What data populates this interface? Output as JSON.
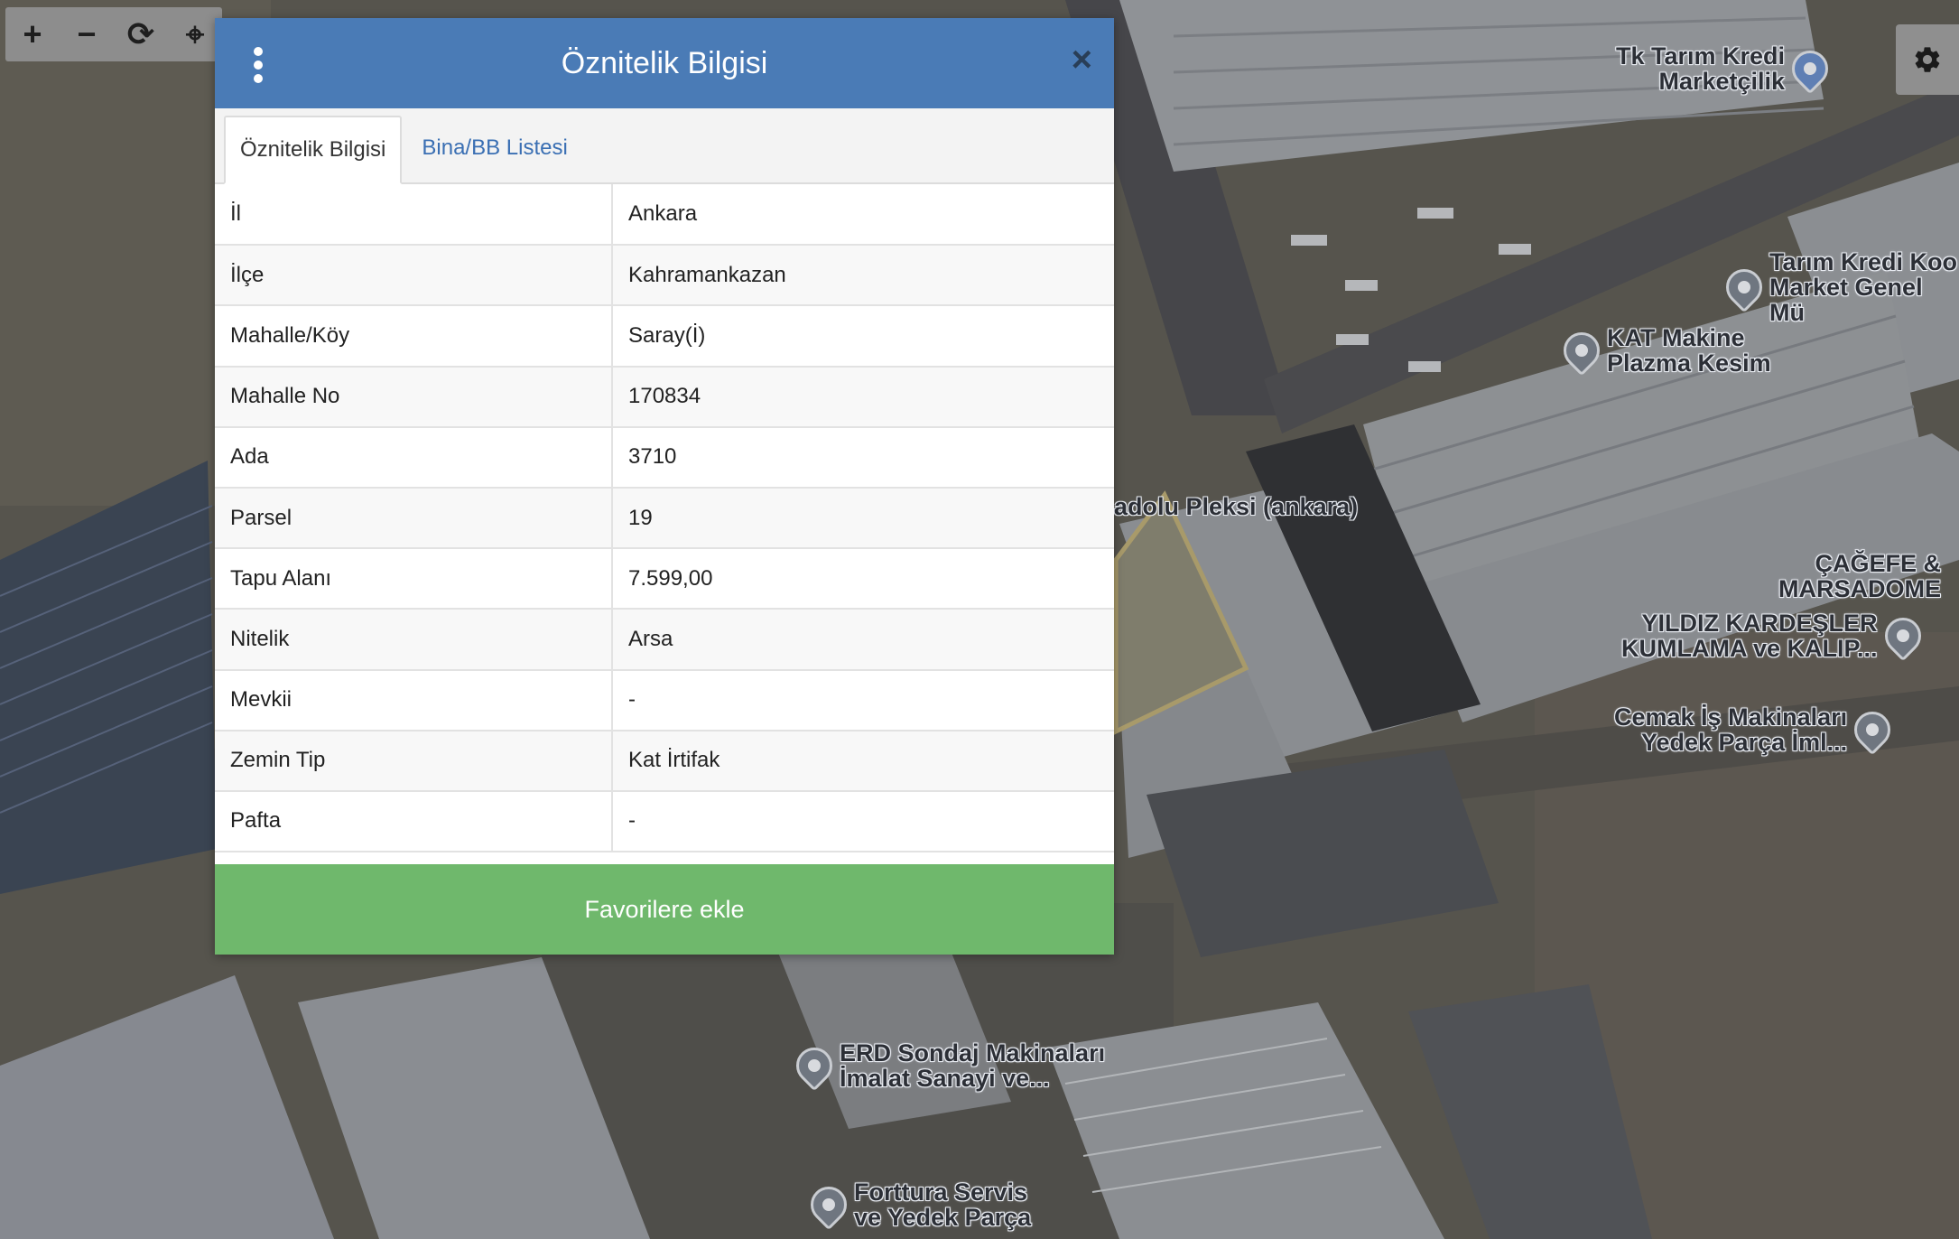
{
  "map": {
    "toolbar": {
      "zoom_in": "+",
      "zoom_out": "−",
      "refresh": "⟳",
      "locate": "⌖"
    },
    "pois": [
      {
        "id": "tk-tarim",
        "text": "Tk Tarım Kredi\nMarketçilik"
      },
      {
        "id": "tarim-kredi-koop",
        "text": "Tarım Kredi Koo\nMarket Genel Mü"
      },
      {
        "id": "kat-makine",
        "text": "KAT Makine\nPlazma Kesim"
      },
      {
        "id": "cagefe",
        "text": "ÇAĞEFE &\nMARSADOME"
      },
      {
        "id": "yildiz",
        "text": "YILDIZ KARDEŞLER\nKUMLAMA ve KALIP..."
      },
      {
        "id": "cemak",
        "text": "Cemak İş Makinaları\nYedek Parça İml..."
      },
      {
        "id": "erd",
        "text": "ERD Sondaj Makinaları\nİmalat Sanayi ve..."
      },
      {
        "id": "forttura",
        "text": "Forttura Servis\nve Yedek Parça"
      }
    ],
    "plain_labels": {
      "anadolu_pleksi": "adolu Pleksi (ankara)"
    },
    "colors": {
      "parcel_outline": "#a89a6a"
    }
  },
  "dialog": {
    "title": "Öznitelik Bilgisi",
    "close": "×",
    "tabs": [
      {
        "label": "Öznitelik Bilgisi",
        "active": true
      },
      {
        "label": "Bina/BB Listesi",
        "active": false
      }
    ],
    "rows": [
      {
        "key": "İl",
        "value": "Ankara"
      },
      {
        "key": "İlçe",
        "value": "Kahramankazan"
      },
      {
        "key": "Mahalle/Köy",
        "value": "Saray(İ)"
      },
      {
        "key": "Mahalle No",
        "value": "170834"
      },
      {
        "key": "Ada",
        "value": "3710"
      },
      {
        "key": "Parsel",
        "value": "19"
      },
      {
        "key": "Tapu Alanı",
        "value": "7.599,00"
      },
      {
        "key": "Nitelik",
        "value": "Arsa"
      },
      {
        "key": "Mevkii",
        "value": "-"
      },
      {
        "key": "Zemin Tip",
        "value": "Kat İrtifak"
      },
      {
        "key": "Pafta",
        "value": "-"
      }
    ],
    "favorite_button": "Favorilere ekle",
    "colors": {
      "header": "#4a7bb6",
      "favorite": "#6fb86c",
      "tab_link": "#3a6fb3"
    }
  }
}
